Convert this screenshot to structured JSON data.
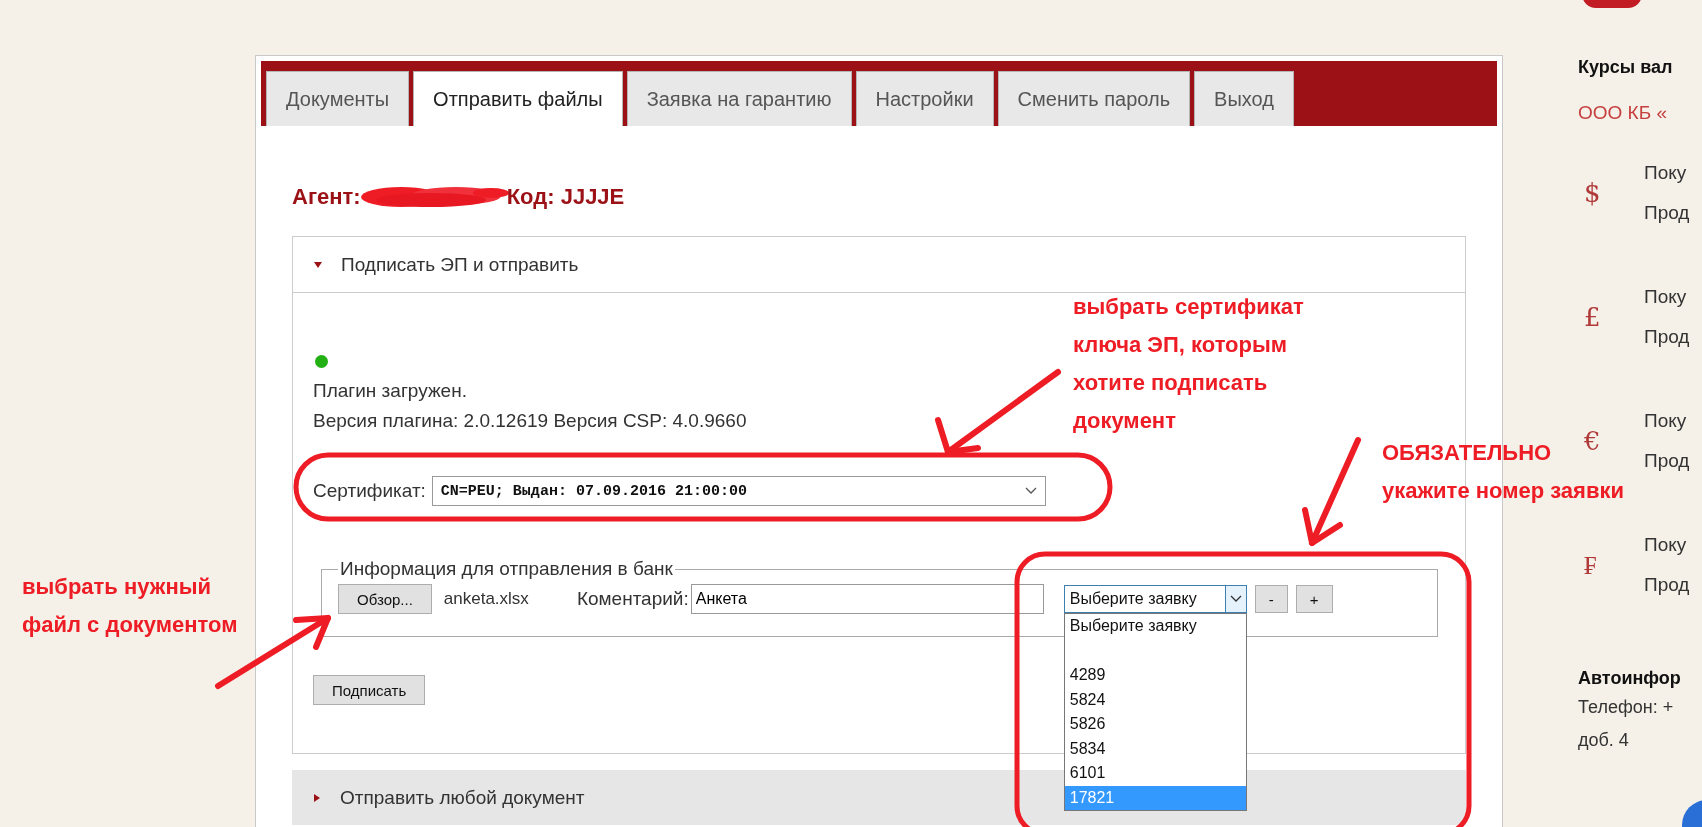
{
  "tabs": [
    {
      "label": "Документы",
      "selected": false
    },
    {
      "label": "Отправить файлы",
      "selected": true
    },
    {
      "label": "Заявка на гарантию",
      "selected": false
    },
    {
      "label": "Настройки",
      "selected": false
    },
    {
      "label": "Сменить пароль",
      "selected": false
    },
    {
      "label": "Выход",
      "selected": false
    }
  ],
  "agent": {
    "label": "Агент:",
    "code": "Код: JJJJE"
  },
  "sections": [
    {
      "title": "Подписать ЭП и отправить",
      "expanded": true
    },
    {
      "title": "Отправить любой документ",
      "expanded": false
    }
  ],
  "plugin": {
    "loaded": true,
    "status": "Плагин загружен.",
    "version": "Версия плагина: 2.0.12619 Версия CSP: 4.0.9660"
  },
  "certificate": {
    "label": "Сертификат:",
    "value": "CN=PEU; Выдан: 07.09.2016 21:00:00"
  },
  "bank_info": {
    "legend": "Информация для отправления в банк",
    "browse_button": "Обзор...",
    "file_name": "anketa.xlsx",
    "comment_label": "Коментарий:",
    "comment_value": "Анкета",
    "request_select": "Выберите заявку",
    "minus_button": "-",
    "plus_button": "+",
    "request_options": [
      {
        "kind": "text",
        "label": "Выберите заявку",
        "selected": false
      },
      {
        "kind": "empty",
        "selected": false
      },
      {
        "kind": "text",
        "label": "4289",
        "selected": false
      },
      {
        "kind": "text",
        "label": "5824",
        "selected": false
      },
      {
        "kind": "text",
        "label": "5826",
        "selected": false
      },
      {
        "kind": "text",
        "label": "5834",
        "selected": false
      },
      {
        "kind": "text",
        "label": "6101",
        "selected": false
      },
      {
        "kind": "text",
        "label": "17821",
        "selected": true
      }
    ]
  },
  "sign_button": "Подписать",
  "sidebar": {
    "rates_title": "Курсы вал",
    "bank_name": "ООО КБ «",
    "currencies": [
      {
        "symbol": "$",
        "buy": "Поку",
        "sell": "Прод"
      },
      {
        "symbol": "£",
        "buy": "Поку",
        "sell": "Прод"
      },
      {
        "symbol": "€",
        "buy": "Поку",
        "sell": "Прод"
      },
      {
        "symbol": "₣",
        "buy": "Поку",
        "sell": "Прод"
      }
    ],
    "autoinfo_title": "Автоинфор",
    "phone": "Телефон: +",
    "extension": "доб. 4"
  },
  "annotations": [
    {
      "lines": [
        "выбрать сертификат",
        "ключа ЭП, которым",
        "хотите подписать",
        "документ"
      ]
    },
    {
      "lines": [
        "ОБЯЗАТЕЛЬНО",
        "укажите номер заявки"
      ]
    },
    {
      "lines": [
        "выбрать нужный",
        "файл с документом"
      ]
    }
  ]
}
